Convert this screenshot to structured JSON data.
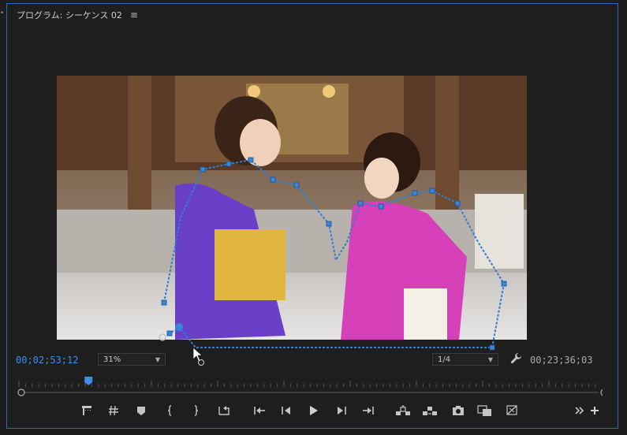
{
  "panel": {
    "title": "プログラム: シーケンス 02",
    "menu_icon": "hamburger-menu-icon"
  },
  "viewer": {
    "mask_tool": "free-draw-bezier-mask"
  },
  "timecode": {
    "current": "00;02;53;12",
    "duration": "00;23;36;03"
  },
  "zoom": {
    "selected": "31%"
  },
  "resolution": {
    "selected": "1/4"
  },
  "timeline": {
    "playhead_position_fraction": 0.12
  },
  "transport_icons": [
    "add-marker-icon",
    "mark-in-icon",
    "mark-out-icon",
    "marker-icon",
    "mark-in-bracket-icon",
    "mark-out-bracket-icon",
    "go-to-in-icon",
    "step-back-icon",
    "play-icon",
    "step-forward-icon",
    "go-to-out-icon",
    "lift-icon",
    "extract-icon",
    "export-frame-icon",
    "comparison-view-icon",
    "proxy-toggle-icon",
    "more-icon",
    "add-button-icon"
  ],
  "colors": {
    "accent_blue": "#3d8ee8",
    "panel_border": "#2e6bb8",
    "background": "#1e1e1e"
  }
}
